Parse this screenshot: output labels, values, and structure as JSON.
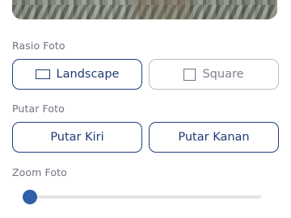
{
  "photo": {
    "alt": "Foto pratinjau"
  },
  "ratio": {
    "label": "Rasio Foto",
    "options": [
      {
        "label": "Landscape",
        "selected": true,
        "icon": "landscape-rect-icon"
      },
      {
        "label": "Square",
        "selected": false,
        "icon": "square-icon"
      }
    ]
  },
  "rotate": {
    "label": "Putar Foto",
    "left": "Putar Kiri",
    "right": "Putar Kanan"
  },
  "zoom": {
    "label": "Zoom Foto",
    "value_fraction": 0.0
  },
  "colors": {
    "accent": "#1f3f7a",
    "thumb": "#2f5fa8",
    "muted_border": "#b7bcc6",
    "label_text": "#6f7480"
  }
}
